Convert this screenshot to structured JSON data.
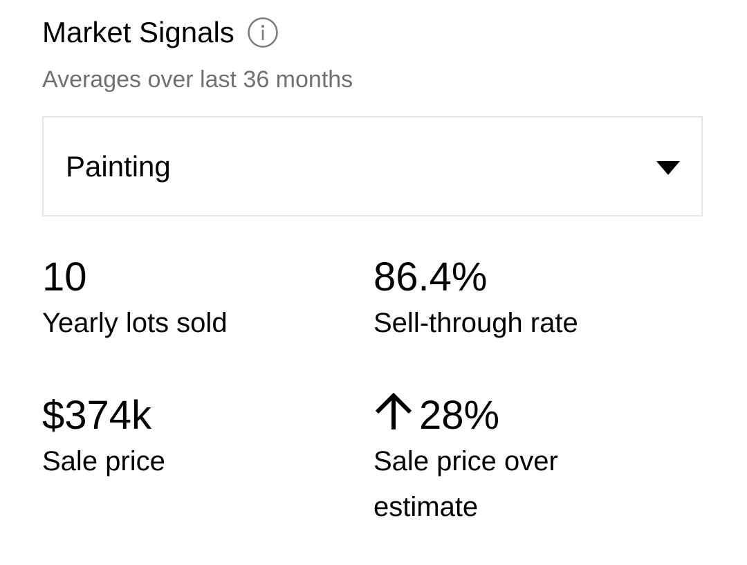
{
  "header": {
    "title": "Market Signals",
    "info_icon": "info-icon",
    "subtitle": "Averages over last 36 months"
  },
  "category_select": {
    "selected_value": "Painting",
    "caret_icon": "caret-down-icon"
  },
  "stats": [
    {
      "value": "10",
      "label": "Yearly lots sold"
    },
    {
      "value": "86.4%",
      "label": "Sell-through rate"
    },
    {
      "value": "$374k",
      "label": "Sale price"
    },
    {
      "value": "28%",
      "label": "Sale price over estimate",
      "trend_icon": "arrow-up-icon",
      "trend": "up"
    }
  ],
  "colors": {
    "text": "#000000",
    "subtitle": "#707070",
    "border": "#e5e5e5",
    "info_icon": "#7a7a7a"
  }
}
